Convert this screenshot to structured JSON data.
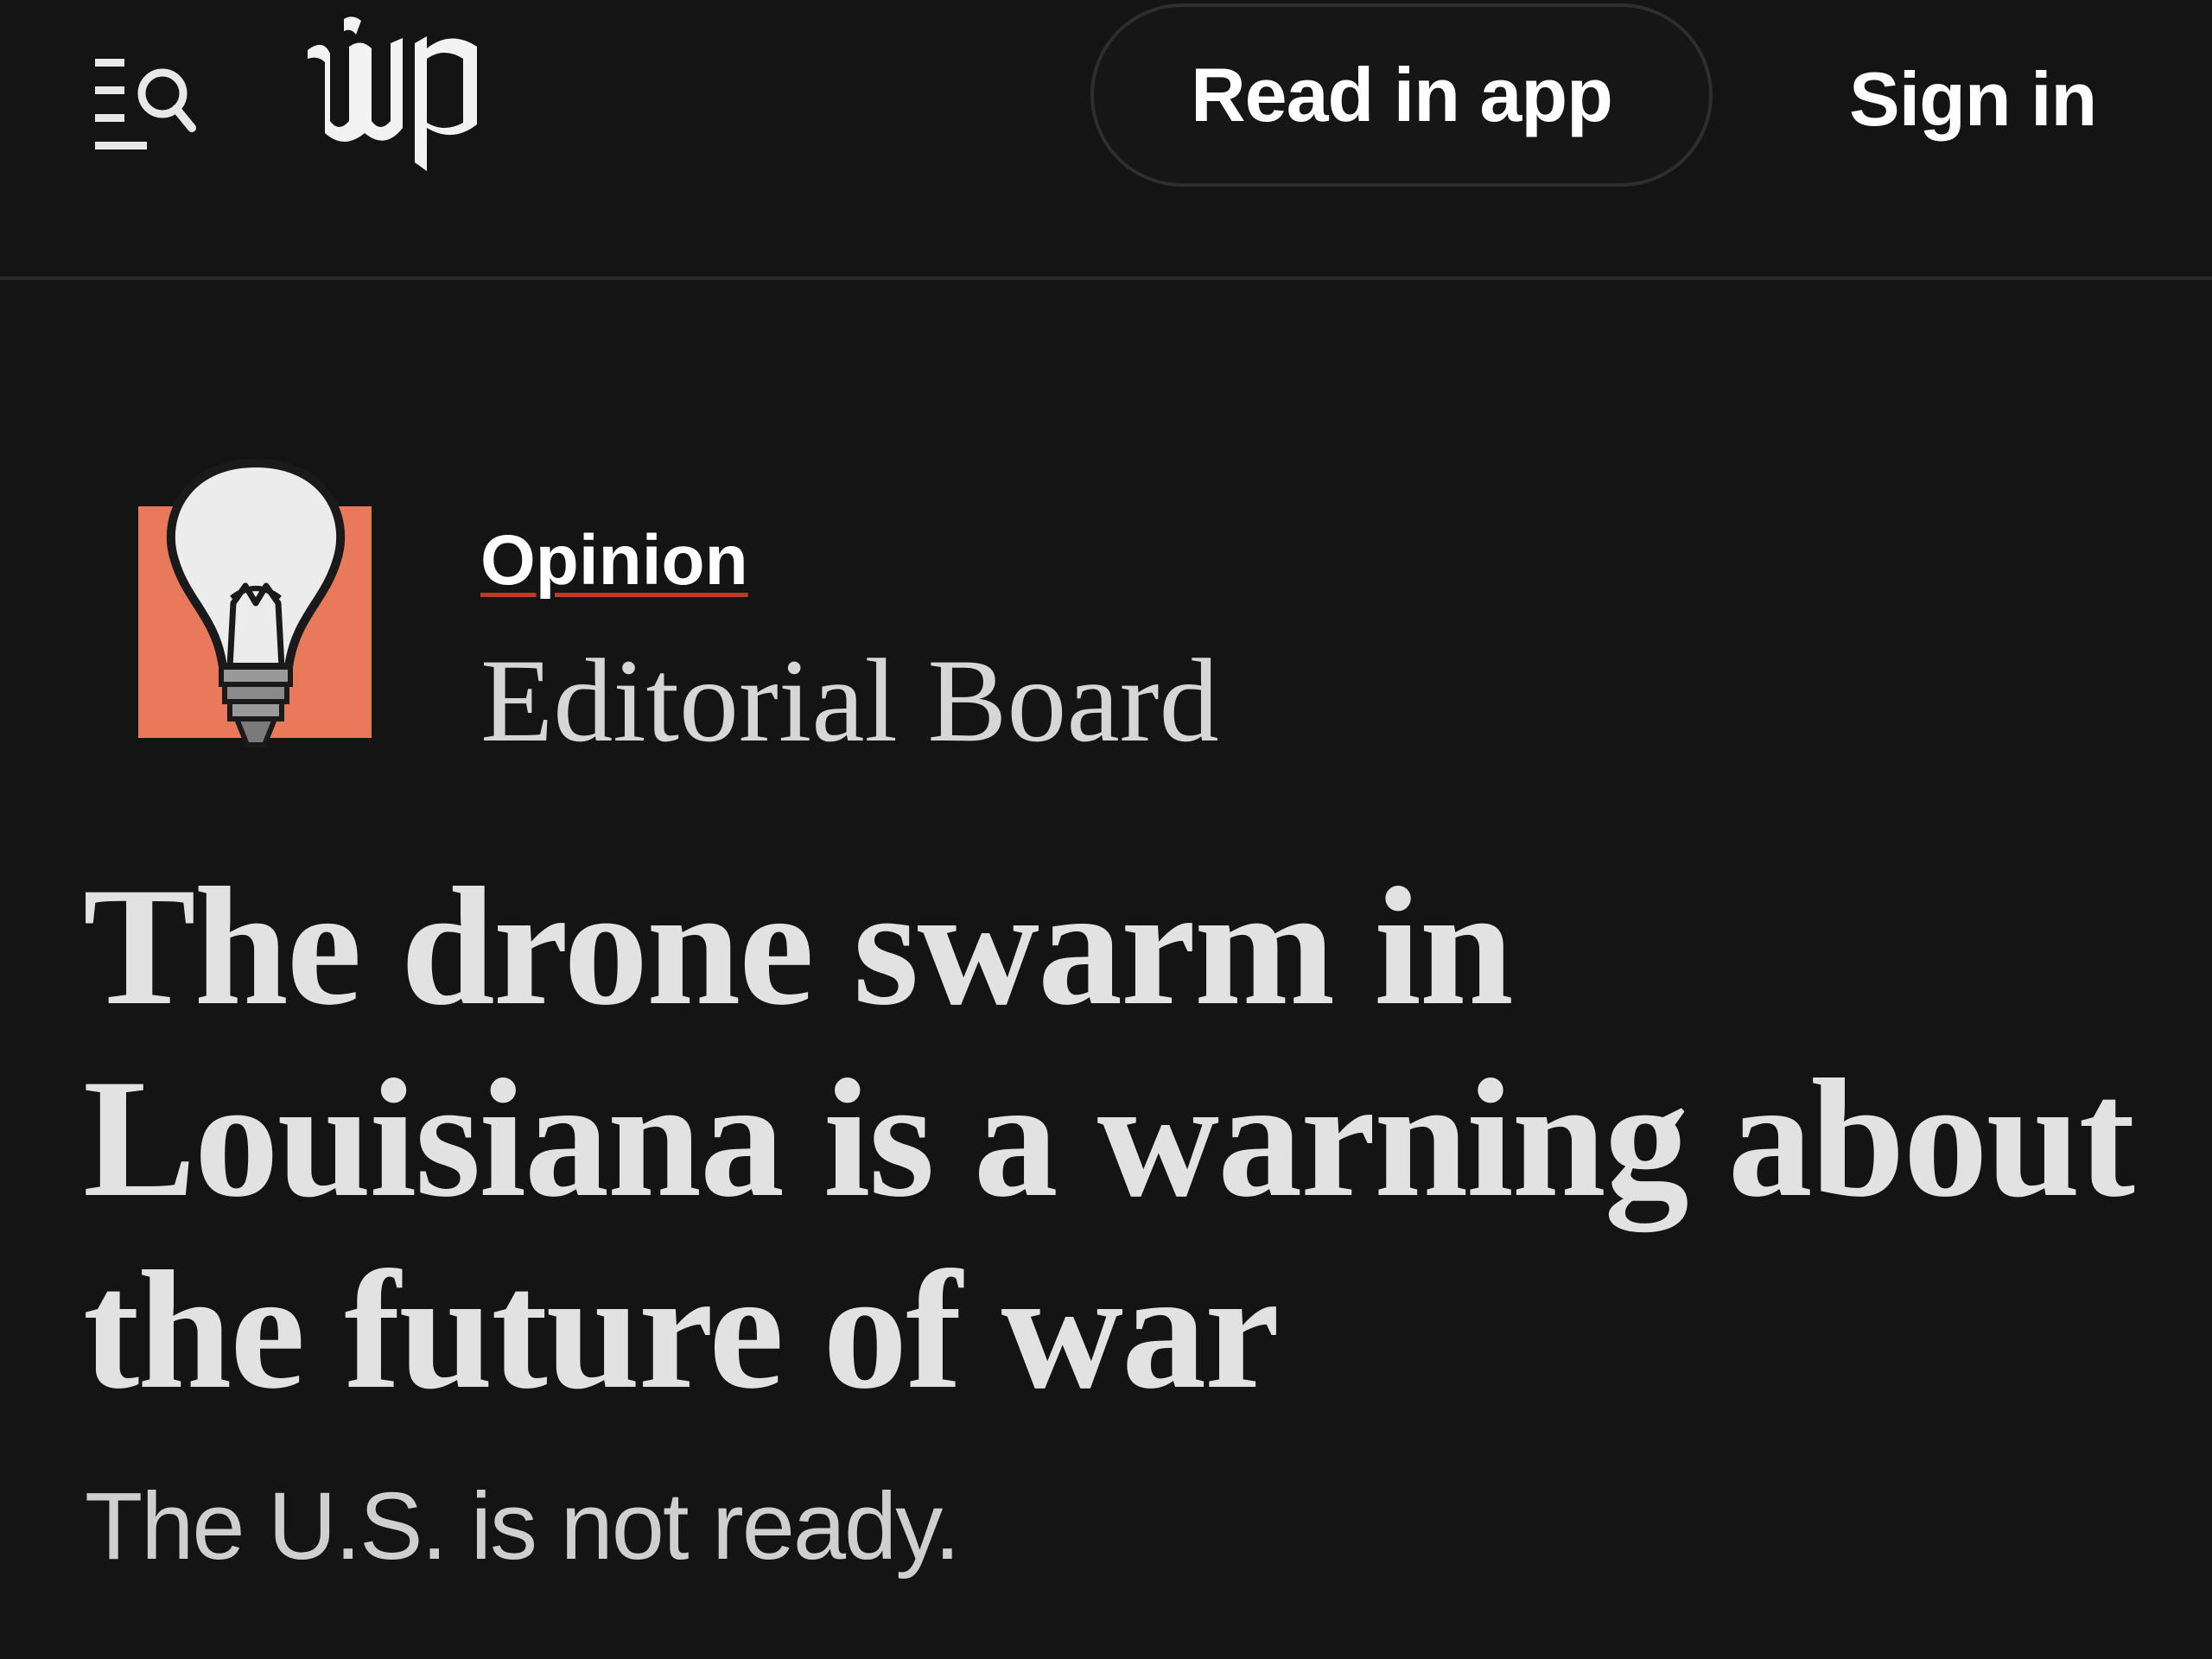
{
  "header": {
    "menu_icon": "menu-search-icon",
    "logo_text": "wp",
    "read_in_app_label": "Read in app",
    "sign_in_label": "Sign in"
  },
  "byline": {
    "avatar_icon": "lightbulb-icon",
    "section_label": "Opinion",
    "author": "Editorial Board"
  },
  "article": {
    "headline": "The drone swarm in Louisiana is a warning about the future of war",
    "subheadline": "The U.S. is not ready."
  },
  "colors": {
    "background": "#141414",
    "text": "#e2e2e2",
    "avatar_accent": "#e8795a",
    "opinion_underline": "#c0392b"
  }
}
